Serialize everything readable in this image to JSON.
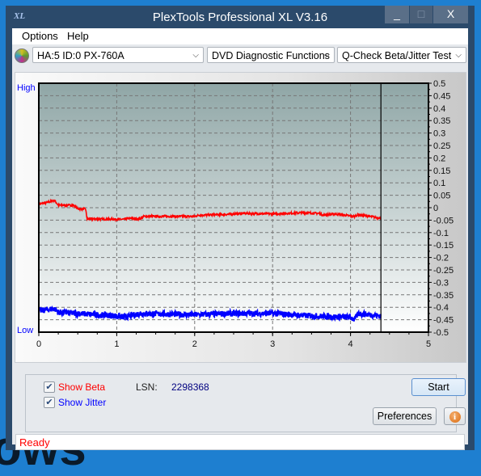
{
  "window": {
    "title": "PlexTools Professional XL V3.16",
    "logo_text": "XL",
    "minimize": "_",
    "maximize": "□",
    "close": "X"
  },
  "menu": {
    "items": [
      "Options",
      "Help"
    ]
  },
  "toolbar": {
    "drive": "HA:5 ID:0  PX-760A",
    "function": "DVD Diagnostic Functions",
    "test": "Q-Check Beta/Jitter Test",
    "drive_icon": "disc-icon"
  },
  "chart_data": {
    "type": "line",
    "xlim": [
      0,
      5
    ],
    "ylim": [
      -0.5,
      0.5
    ],
    "x_ticks": [
      "0",
      "1",
      "2",
      "3",
      "4",
      "5"
    ],
    "y_ticks": [
      "0.5",
      "0.45",
      "0.4",
      "0.35",
      "0.3",
      "0.25",
      "0.2",
      "0.15",
      "0.1",
      "0.05",
      "0",
      "-0.05",
      "-0.1",
      "-0.15",
      "-0.2",
      "-0.25",
      "-0.3",
      "-0.35",
      "-0.4",
      "-0.45",
      "-0.5"
    ],
    "left_labels": {
      "high": "High",
      "low": "Low"
    },
    "grid": true,
    "end_marker_x": 4.39,
    "series": [
      {
        "key": "beta",
        "color": "#ff0000",
        "points": [
          [
            0,
            0.015
          ],
          [
            0.1,
            0.02
          ],
          [
            0.2,
            0.03
          ],
          [
            0.25,
            0.01
          ],
          [
            0.45,
            0.01
          ],
          [
            0.5,
            -0.005
          ],
          [
            0.6,
            -0.005
          ],
          [
            0.62,
            -0.045
          ],
          [
            1.1,
            -0.047
          ],
          [
            1.15,
            -0.043
          ],
          [
            1.3,
            -0.045
          ],
          [
            1.35,
            -0.035
          ],
          [
            2.0,
            -0.035
          ],
          [
            2.05,
            -0.03
          ],
          [
            2.4,
            -0.027
          ],
          [
            2.6,
            -0.023
          ],
          [
            3.0,
            -0.025
          ],
          [
            3.4,
            -0.02
          ],
          [
            3.6,
            -0.023
          ],
          [
            3.65,
            -0.03
          ],
          [
            3.8,
            -0.025
          ],
          [
            4.05,
            -0.035
          ],
          [
            4.1,
            -0.028
          ],
          [
            4.39,
            -0.042
          ]
        ]
      },
      {
        "key": "jitter",
        "color": "#0000ff",
        "points": [
          [
            0,
            -0.415
          ],
          [
            0.2,
            -0.405
          ],
          [
            0.25,
            -0.42
          ],
          [
            1.0,
            -0.435
          ],
          [
            1.1,
            -0.44
          ],
          [
            1.3,
            -0.425
          ],
          [
            2.0,
            -0.43
          ],
          [
            2.5,
            -0.425
          ],
          [
            3.0,
            -0.425
          ],
          [
            3.5,
            -0.435
          ],
          [
            4.0,
            -0.44
          ],
          [
            4.05,
            -0.45
          ],
          [
            4.1,
            -0.425
          ],
          [
            4.39,
            -0.435
          ]
        ]
      }
    ]
  },
  "controls": {
    "show_beta": {
      "label": "Show Beta",
      "checked": true,
      "color": "#ff0000"
    },
    "show_jitter": {
      "label": "Show Jitter",
      "checked": true,
      "color": "#0000ff"
    },
    "lsn_label": "LSN:",
    "lsn_value": "2298368",
    "start": "Start",
    "preferences": "Preferences",
    "info_icon": "info-icon"
  },
  "status": {
    "text": "Ready"
  }
}
